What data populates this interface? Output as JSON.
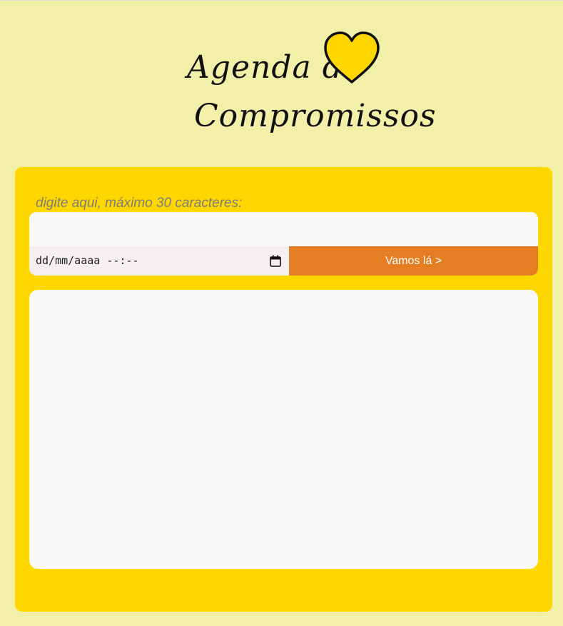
{
  "header": {
    "title_line1": "Agenda de",
    "title_line2": "Compromissos",
    "heart_icon": "heart-icon",
    "heart_color": "#ffd700"
  },
  "form": {
    "hint": "digite aqui, máximo 30 caracteres:",
    "task_value": "",
    "date_placeholder": "dd/mm/aaaa --:--",
    "calendar_icon": "calendar-icon",
    "submit_label": "Vamos lá >"
  },
  "colors": {
    "page_bg": "#f1efa8",
    "card_bg": "#ffd700",
    "button_bg": "#e57d23"
  },
  "list": {
    "items": []
  }
}
